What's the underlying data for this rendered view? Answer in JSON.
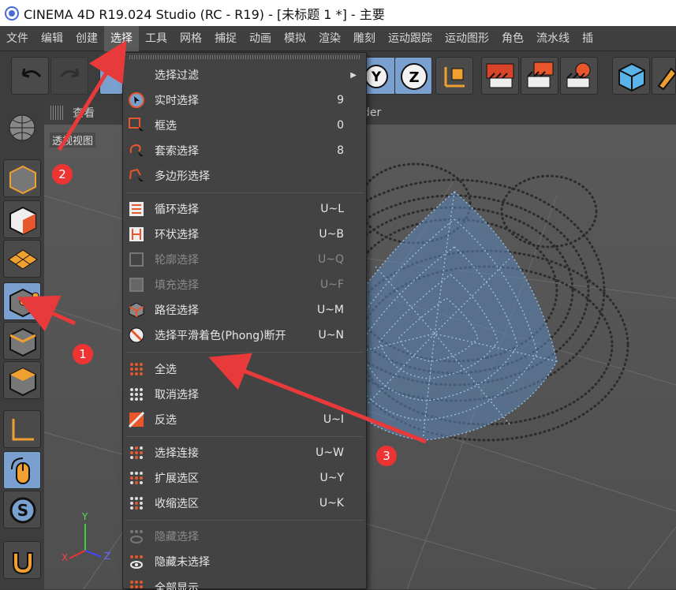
{
  "window": {
    "title": "CINEMA 4D R19.024 Studio (RC - R19) - [未标题 1 *] - 主要"
  },
  "menubar": [
    "文件",
    "编辑",
    "创建",
    "选择",
    "工具",
    "网格",
    "捕捉",
    "动画",
    "模拟",
    "渲染",
    "雕刻",
    "运动跟踪",
    "运动图形",
    "角色",
    "流水线",
    "插"
  ],
  "viewport": {
    "header_items": [
      "查看",
      "der"
    ],
    "label": "透视视图",
    "axes": {
      "x": "X",
      "y": "Y",
      "z": "Z"
    }
  },
  "toolbar": {
    "axis_y": "Y",
    "axis_z": "Z"
  },
  "select_menu": {
    "items": [
      {
        "label": "选择过滤",
        "shortcut": "",
        "icon": "none",
        "submenu": true,
        "disabled": false
      },
      {
        "label": "实时选择",
        "shortcut": "9",
        "icon": "live-select-icon",
        "disabled": false
      },
      {
        "label": "框选",
        "shortcut": "0",
        "icon": "rectangle-select-icon",
        "disabled": false
      },
      {
        "label": "套索选择",
        "shortcut": "8",
        "icon": "lasso-select-icon",
        "disabled": false
      },
      {
        "label": "多边形选择",
        "shortcut": "",
        "icon": "polygon-select-icon",
        "disabled": false
      },
      {
        "label": "循环选择",
        "shortcut": "U~L",
        "icon": "loop-select-icon",
        "disabled": false
      },
      {
        "label": "环状选择",
        "shortcut": "U~B",
        "icon": "ring-select-icon",
        "disabled": false
      },
      {
        "label": "轮廓选择",
        "shortcut": "U~Q",
        "icon": "outline-select-icon",
        "disabled": true
      },
      {
        "label": "填充选择",
        "shortcut": "U~F",
        "icon": "fill-select-icon",
        "disabled": true
      },
      {
        "label": "路径选择",
        "shortcut": "U~M",
        "icon": "path-select-icon",
        "disabled": false
      },
      {
        "label": "选择平滑着色(Phong)断开",
        "shortcut": "U~N",
        "icon": "phong-break-icon",
        "disabled": false
      },
      {
        "label": "全选",
        "shortcut": "",
        "icon": "select-all-icon",
        "disabled": false
      },
      {
        "label": "取消选择",
        "shortcut": "",
        "icon": "deselect-icon",
        "disabled": false
      },
      {
        "label": "反选",
        "shortcut": "U~I",
        "icon": "invert-select-icon",
        "disabled": false
      },
      {
        "label": "选择连接",
        "shortcut": "U~W",
        "icon": "select-connected-icon",
        "disabled": false
      },
      {
        "label": "扩展选区",
        "shortcut": "U~Y",
        "icon": "grow-select-icon",
        "disabled": false
      },
      {
        "label": "收缩选区",
        "shortcut": "U~K",
        "icon": "shrink-select-icon",
        "disabled": false
      },
      {
        "label": "隐藏选择",
        "shortcut": "",
        "icon": "hide-selected-icon",
        "disabled": true
      },
      {
        "label": "隐藏未选择",
        "shortcut": "",
        "icon": "hide-unselected-icon",
        "disabled": false
      },
      {
        "label": "全部显示",
        "shortcut": "",
        "icon": "unhide-all-icon",
        "disabled": false
      }
    ]
  },
  "annotations": [
    "1",
    "2",
    "3"
  ],
  "colors": {
    "annotation": "#e83a3a",
    "mesh": "#5b86b8",
    "active": "#7aa0cf"
  }
}
